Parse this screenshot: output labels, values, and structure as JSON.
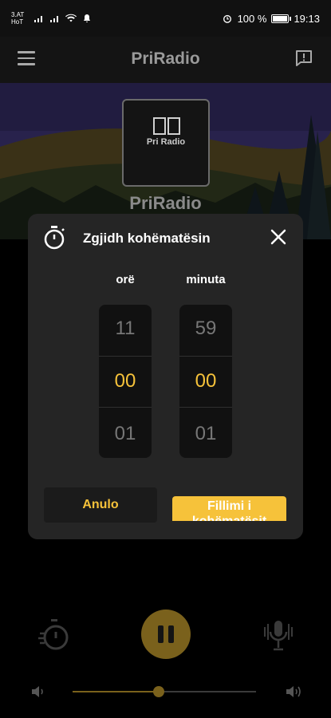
{
  "status_bar": {
    "carrier1": "3.AT",
    "carrier2": "HoT",
    "battery": "100 %",
    "time": "19:13"
  },
  "app_bar": {
    "title": "PriRadio",
    "menu_icon": "hamburger-menu-icon",
    "report_icon": "report-icon"
  },
  "station": {
    "logo_text": "Pri Radio",
    "name": "PriRadio"
  },
  "dialog": {
    "title": "Zgjidh kohëmatësin",
    "hours": {
      "label": "orë",
      "prev": "11",
      "current": "00",
      "next": "01"
    },
    "minutes": {
      "label": "minuta",
      "prev": "59",
      "current": "00",
      "next": "01"
    },
    "cancel_label": "Anulo",
    "start_label": "Fillimi i kohëmatësit"
  },
  "player": {
    "volume_level": 0.47
  },
  "colors": {
    "accent": "#f6c23a",
    "dialog_bg": "#252525",
    "picker_bg": "#111111"
  }
}
